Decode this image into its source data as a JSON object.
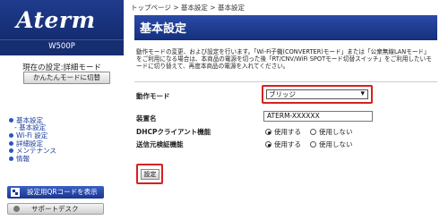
{
  "sidebar": {
    "logo": "Aterm",
    "model": "W500P",
    "current_mode": "現在の設定:詳細モード",
    "simple_mode_button": "かんたんモードに切替",
    "nav": {
      "basic": "基本設定",
      "basic_sub": "- 基本設定",
      "wifi": "Wi-Fi 設定",
      "detail": "詳細設定",
      "maintenance": "メンテナンス",
      "info": "情報"
    },
    "qr_button": "設定用QRコードを表示",
    "support_button": "サポートデスク"
  },
  "main": {
    "breadcrumb": "トップページ > 基本設定 > 基本設定",
    "title": "基本設定",
    "description": "動作モードの変更、および設定を行います。「Wi-Fi子機(CONVERTER)モード」または「公衆無線LANモード」をご利用になる場合は、本商品の電源を切った後「RT/CNV/WiFi SPOTモード切替スイッチ」をご利用したいモードに切り替えて、再度本商品の電源を入れてください。",
    "operation_mode": {
      "label": "動作モード",
      "value": "ブリッジ"
    },
    "device_name": {
      "label": "装置名",
      "value": "ATERM-XXXXXX"
    },
    "dhcp": {
      "label": "DHCPクライアント機能",
      "options": [
        "使用する",
        "使用しない"
      ],
      "selected": 0
    },
    "sender_check": {
      "label": "送信元検証機能",
      "options": [
        "使用する",
        "使用しない"
      ],
      "selected": 0
    },
    "submit_button": "設定"
  }
}
